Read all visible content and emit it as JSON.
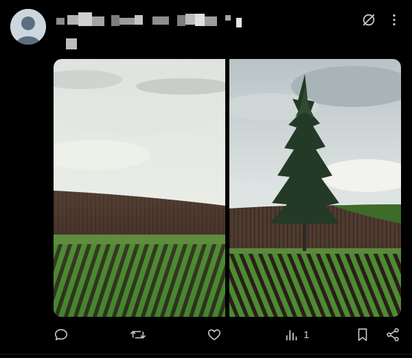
{
  "post": {
    "author_name": "",
    "author_handle": "",
    "colors": {
      "background": "#000000",
      "icon": "#c4c9cd",
      "avatar_bg": "#ccd6dd",
      "avatar_fg": "#5b6e7f"
    },
    "top_icons": [
      "grok-slash-icon",
      "more-vertical-icon"
    ],
    "media": [
      {
        "kind": "photo",
        "subject": "wheat-field-landscape"
      },
      {
        "kind": "photo",
        "subject": "lone-tree-field-landscape"
      }
    ],
    "actions": {
      "reply": {
        "icon": "reply-icon",
        "count": ""
      },
      "repost": {
        "icon": "repost-icon",
        "count": ""
      },
      "like": {
        "icon": "heart-icon",
        "count": ""
      },
      "views": {
        "icon": "views-icon",
        "count": "1"
      },
      "bookmark": {
        "icon": "bookmark-icon",
        "count": ""
      },
      "share": {
        "icon": "share-icon",
        "count": ""
      }
    }
  }
}
